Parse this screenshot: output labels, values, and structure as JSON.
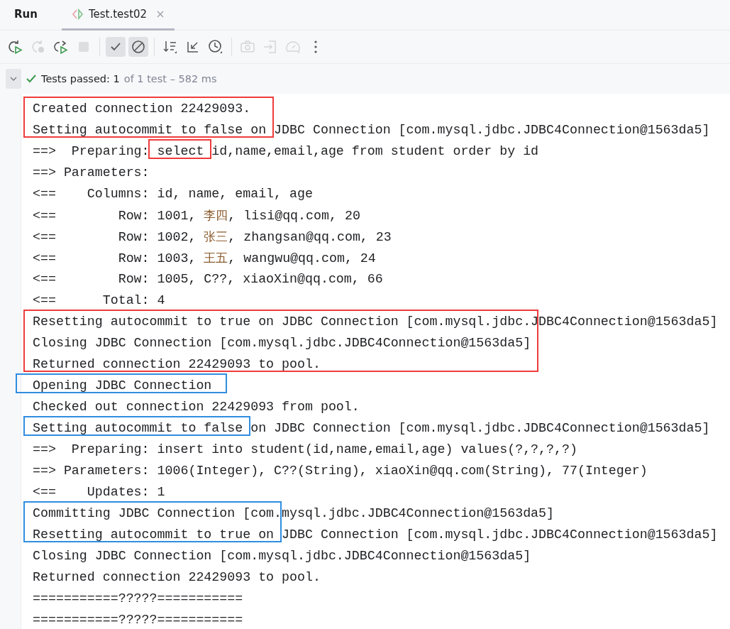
{
  "tabs": [
    {
      "label": "Run",
      "kind": "title",
      "selected": false
    },
    {
      "label": "Test.test02",
      "kind": "test",
      "selected": true
    }
  ],
  "toolbar": [
    {
      "kind": "rerun",
      "disabled": false,
      "selected": false
    },
    {
      "kind": "rerun-failed",
      "disabled": true,
      "selected": false
    },
    {
      "kind": "rerun-toggle",
      "disabled": false,
      "selected": false
    },
    {
      "kind": "stop",
      "disabled": true,
      "selected": false
    },
    {
      "kind": "sep"
    },
    {
      "kind": "show-passed",
      "disabled": false,
      "selected": true
    },
    {
      "kind": "show-ignored",
      "disabled": false,
      "selected": true
    },
    {
      "kind": "sep"
    },
    {
      "kind": "sort",
      "disabled": false,
      "selected": false
    },
    {
      "kind": "collapse",
      "disabled": false,
      "selected": false
    },
    {
      "kind": "history",
      "disabled": false,
      "selected": false
    },
    {
      "kind": "sep"
    },
    {
      "kind": "camera",
      "disabled": true,
      "selected": false
    },
    {
      "kind": "import",
      "disabled": true,
      "selected": false
    },
    {
      "kind": "gauge",
      "disabled": true,
      "selected": false
    },
    {
      "kind": "more",
      "disabled": false,
      "selected": false
    }
  ],
  "status": {
    "expanded": true,
    "passed": "Tests passed: 1",
    "detail": "of 1 test – 582 ms"
  },
  "console": {
    "lines": [
      "Created connection 22429093.",
      "Setting autocommit to false on JDBC Connection [com.mysql.jdbc.JDBC4Connection@1563da5]",
      "==>  Preparing: select id,name,email,age from student order by id",
      "==> Parameters: ",
      "<==    Columns: id, name, email, age",
      "<==        Row: 1001, 李四, lisi@qq.com, 20",
      "<==        Row: 1002, 张三, zhangsan@qq.com, 23",
      "<==        Row: 1003, 王五, wangwu@qq.com, 24",
      "<==        Row: 1005, C??, xiaoXin@qq.com, 66",
      "<==      Total: 4",
      "Resetting autocommit to true on JDBC Connection [com.mysql.jdbc.JDBC4Connection@1563da5]",
      "Closing JDBC Connection [com.mysql.jdbc.JDBC4Connection@1563da5]",
      "Returned connection 22429093 to pool.",
      "Opening JDBC Connection",
      "Checked out connection 22429093 from pool.",
      "Setting autocommit to false on JDBC Connection [com.mysql.jdbc.JDBC4Connection@1563da5]",
      "==>  Preparing: insert into student(id,name,email,age) values(?,?,?,?)",
      "==> Parameters: 1006(Integer), C??(String), xiaoXin@qq.com(String), 77(Integer)",
      "<==    Updates: 1",
      "Committing JDBC Connection [com.mysql.jdbc.JDBC4Connection@1563da5]",
      "Resetting autocommit to true on JDBC Connection [com.mysql.jdbc.JDBC4Connection@1563da5]",
      "Closing JDBC Connection [com.mysql.jdbc.JDBC4Connection@1563da5]",
      "Returned connection 22429093 to pool.",
      "===========?????===========",
      "===========?????==========="
    ],
    "highlights": [
      {
        "color": "#ef3b3b"
      },
      {
        "color": "#ef3b3b"
      },
      {
        "color": "#ef3b3b"
      },
      {
        "color": "#2f8ee0"
      },
      {
        "color": "#2f8ee0"
      },
      {
        "color": "#2f8ee0"
      }
    ]
  }
}
